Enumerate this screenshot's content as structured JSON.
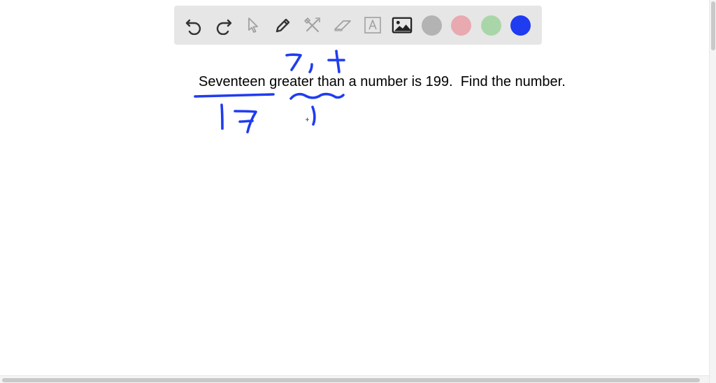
{
  "toolbar": {
    "tools": [
      {
        "name": "undo-icon",
        "enabled": true
      },
      {
        "name": "redo-icon",
        "enabled": true
      },
      {
        "name": "select-pointer-icon",
        "enabled": false
      },
      {
        "name": "pen-icon",
        "enabled": true
      },
      {
        "name": "tools-icon",
        "enabled": false
      },
      {
        "name": "eraser-icon",
        "enabled": false
      },
      {
        "name": "text-box-icon",
        "enabled": false
      },
      {
        "name": "image-icon",
        "enabled": true
      }
    ],
    "colors": [
      {
        "name": "gray",
        "hex": "#b3b3b3"
      },
      {
        "name": "pink",
        "hex": "#e9a9b0"
      },
      {
        "name": "green",
        "hex": "#a9d6a9"
      },
      {
        "name": "blue",
        "hex": "#1f3cf0"
      }
    ]
  },
  "canvas": {
    "problem_text": "Seventeen greater than a number is 199.  Find the number.",
    "ink_color": "#1f3cf0"
  }
}
